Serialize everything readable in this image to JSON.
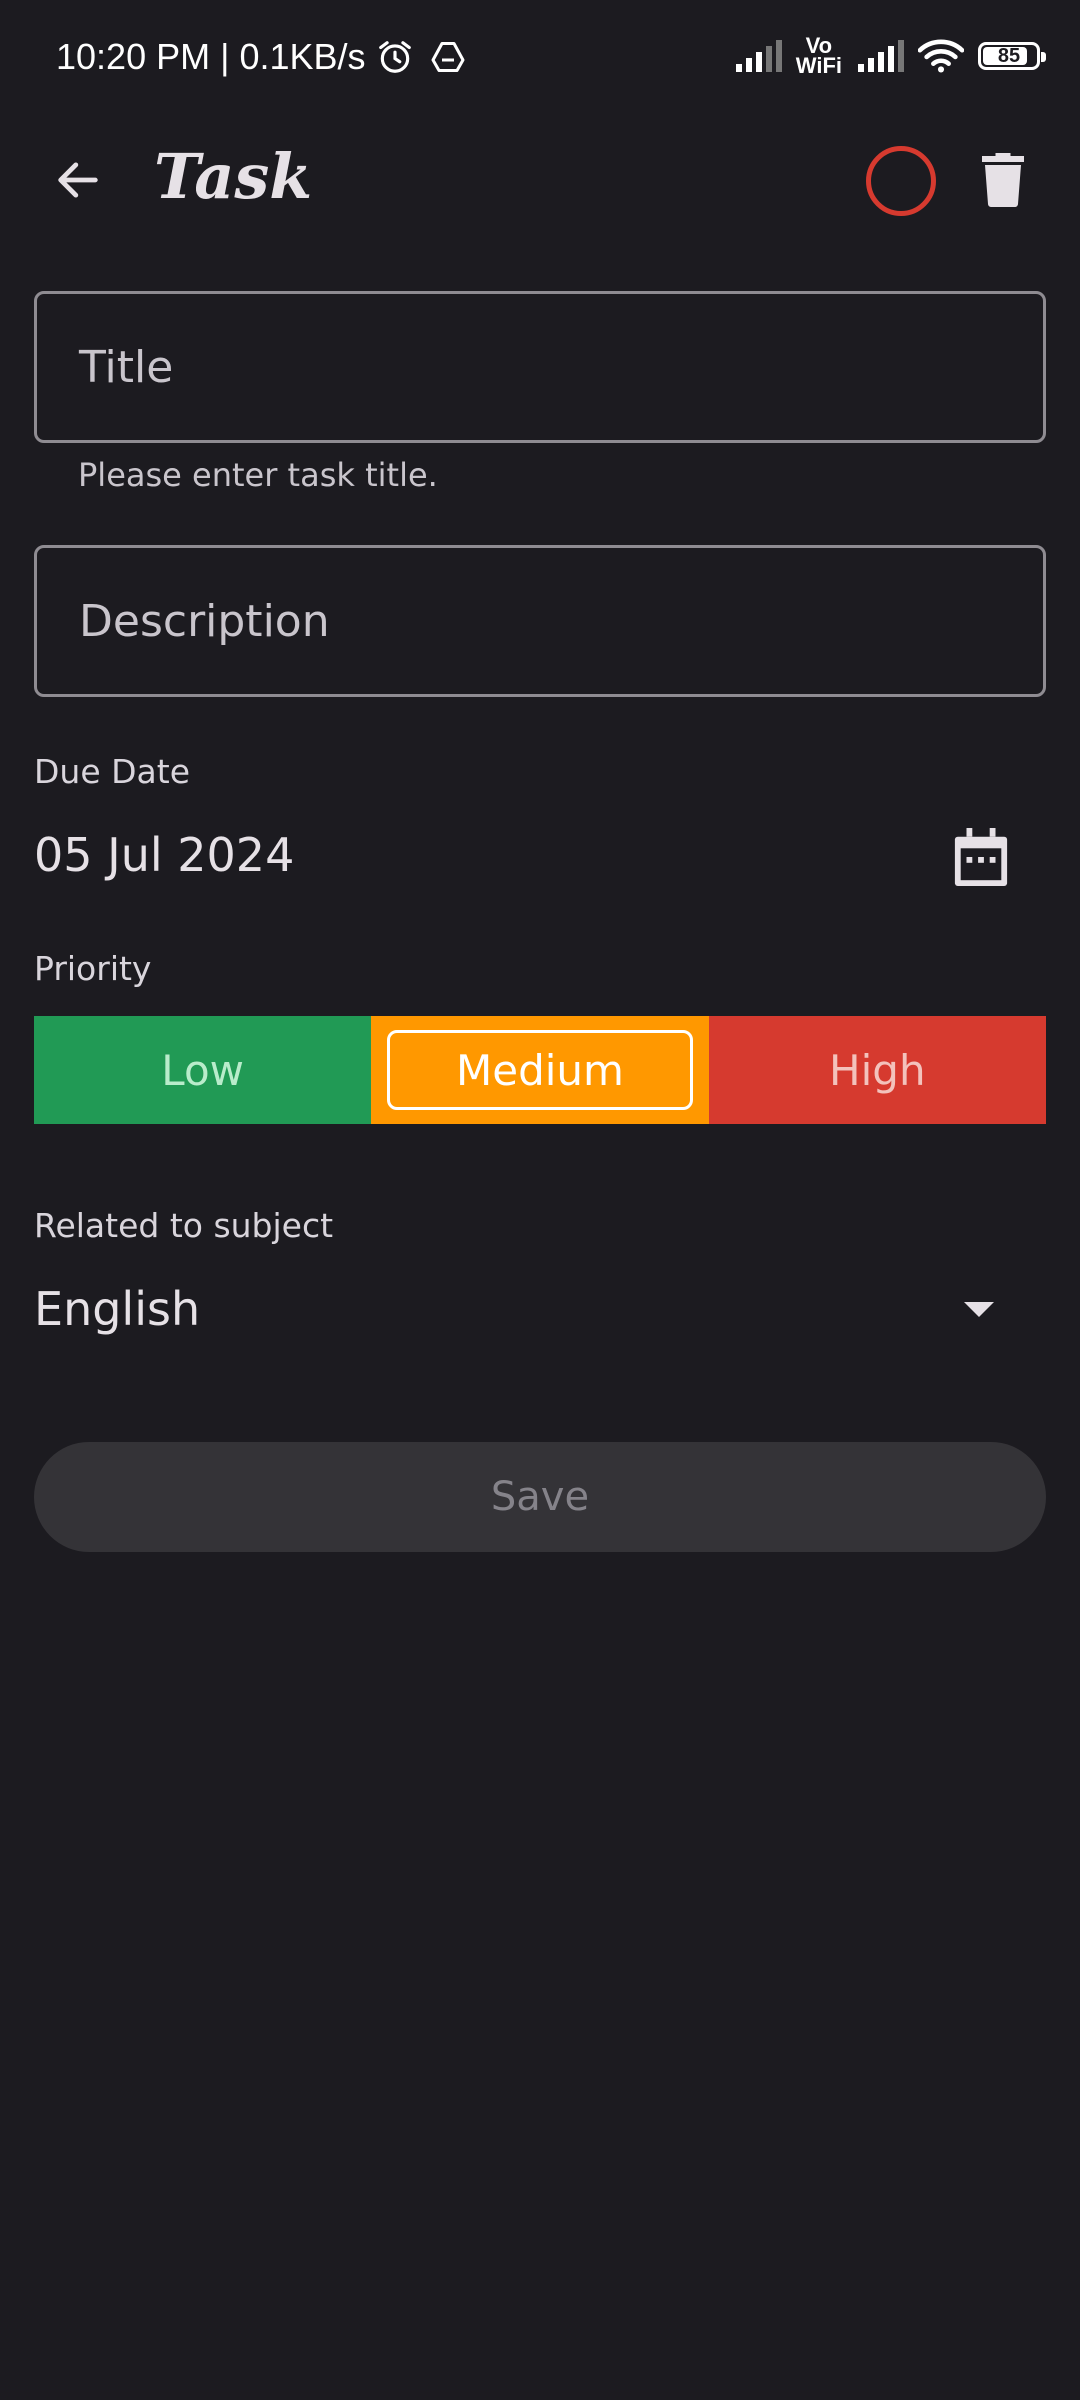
{
  "status_bar": {
    "time_speed": "10:20 PM | 0.1KB/s",
    "vowifi_top": "Vo",
    "vowifi_bottom": "WiFi",
    "battery": "85",
    "battery_level_percent": 85,
    "icons": [
      "alarm-icon",
      "drive-icon",
      "signal-icon",
      "vowifi-icon",
      "signal-icon",
      "wifi-icon",
      "battery-icon"
    ]
  },
  "app_bar": {
    "title": "Task",
    "icons": [
      "back-arrow-icon",
      "task-status-circle-icon",
      "trash-icon"
    ],
    "status_color": "#d63a2f"
  },
  "form": {
    "title_placeholder": "Title",
    "title_helper": "Please enter task title.",
    "description_placeholder": "Description",
    "due_date_label": "Due Date",
    "due_date_value": "05 Jul 2024",
    "calendar_icon": "calendar-icon",
    "priority_label": "Priority",
    "priorities": [
      {
        "label": "Low",
        "color": "#219a55"
      },
      {
        "label": "Medium",
        "color": "#ff9800",
        "selected": true
      },
      {
        "label": "High",
        "color": "#d63a2f"
      }
    ],
    "subject_label": "Related to subject",
    "subject_value": "English",
    "dropdown_icon": "dropdown-arrow-icon",
    "save_label": "Save"
  },
  "colors": {
    "background": "#1c1b20",
    "save_disabled_bg": "#343337"
  }
}
